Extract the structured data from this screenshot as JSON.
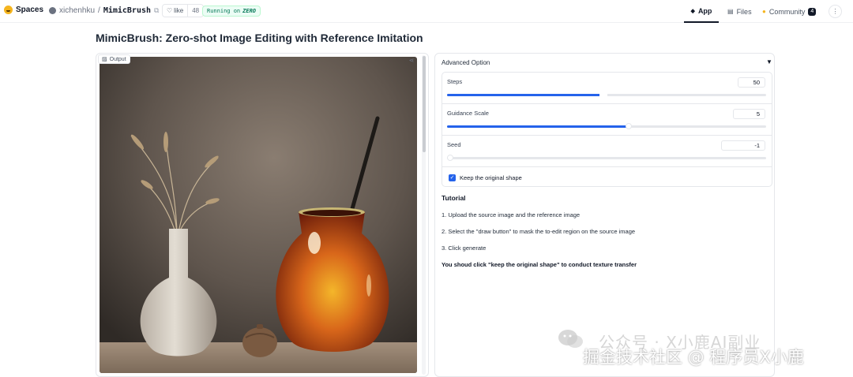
{
  "topbar": {
    "spaces_label": "Spaces",
    "owner": "xichenhku",
    "separator": "/",
    "repo": "MimicBrush",
    "like_label": "like",
    "like_count": "48",
    "running_prefix": "Running on",
    "running_hardware": "ZERO",
    "tabs": [
      {
        "label": "App",
        "active": true,
        "icon": "app-icon"
      },
      {
        "label": "Files",
        "active": false,
        "icon": "files-icon"
      },
      {
        "label": "Community",
        "active": false,
        "icon": "community-icon",
        "badge": "4"
      }
    ],
    "menu_icon": "kebab-icon"
  },
  "page": {
    "title": "MimicBrush: Zero-shot Image Editing with Reference Imitation"
  },
  "output": {
    "label": "Output",
    "label_icon": "image-icon",
    "share_icon": "share-icon"
  },
  "advanced": {
    "title": "Advanced Option",
    "expanded": true,
    "steps": {
      "label": "Steps",
      "value": "50",
      "fraction": 0.49
    },
    "guidance": {
      "label": "Guidance Scale",
      "value": "5",
      "fraction": 0.57
    },
    "seed": {
      "label": "Seed",
      "value": "-1",
      "fraction": 0.0
    },
    "keep_shape": {
      "label": "Keep the original shape",
      "checked": true
    }
  },
  "tutorial": {
    "title": "Tutorial",
    "steps": [
      "1. Upload the source image and the reference image",
      "2. Select the \"draw button\" to mask the to-edit region on the source image",
      "3. Click generate"
    ],
    "note": "You shoud click \"keep the original shape\" to conduct texture transfer"
  },
  "watermark": {
    "line1": "公众号 · X小鹿AI副业",
    "line2": "掘金技术社区 @ 程序员X小鹿"
  },
  "colors": {
    "accent": "#2563eb",
    "running_bg": "#ecfdf5",
    "running_text": "#047857",
    "spaces_logo": "#f5b51f"
  }
}
